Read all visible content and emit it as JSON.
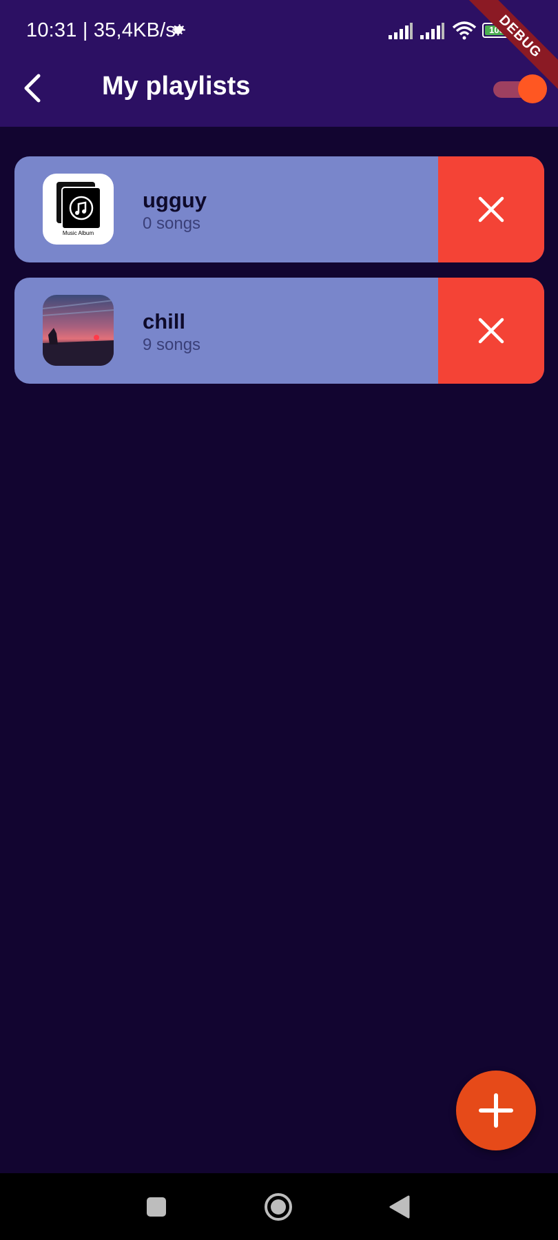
{
  "status_bar": {
    "text": "10:31 | 35,4KB/s",
    "battery": "100"
  },
  "debug_banner": "DEBUG",
  "app_bar": {
    "title": "My playlists"
  },
  "playlists": [
    {
      "name": "ugguy",
      "count": "0 songs",
      "cover_caption": "Music Album"
    },
    {
      "name": "chill",
      "count": "9 songs"
    }
  ],
  "colors": {
    "background": "#120530",
    "app_bar": "#2c1063",
    "card": "#7986cb",
    "delete": "#f44336",
    "fab": "#e64a19",
    "toggle_thumb": "#ff5722"
  },
  "icons": {
    "back": "chevron-left-icon",
    "theme_toggle": "toggle-switch",
    "delete": "close-icon",
    "add": "plus-icon"
  }
}
